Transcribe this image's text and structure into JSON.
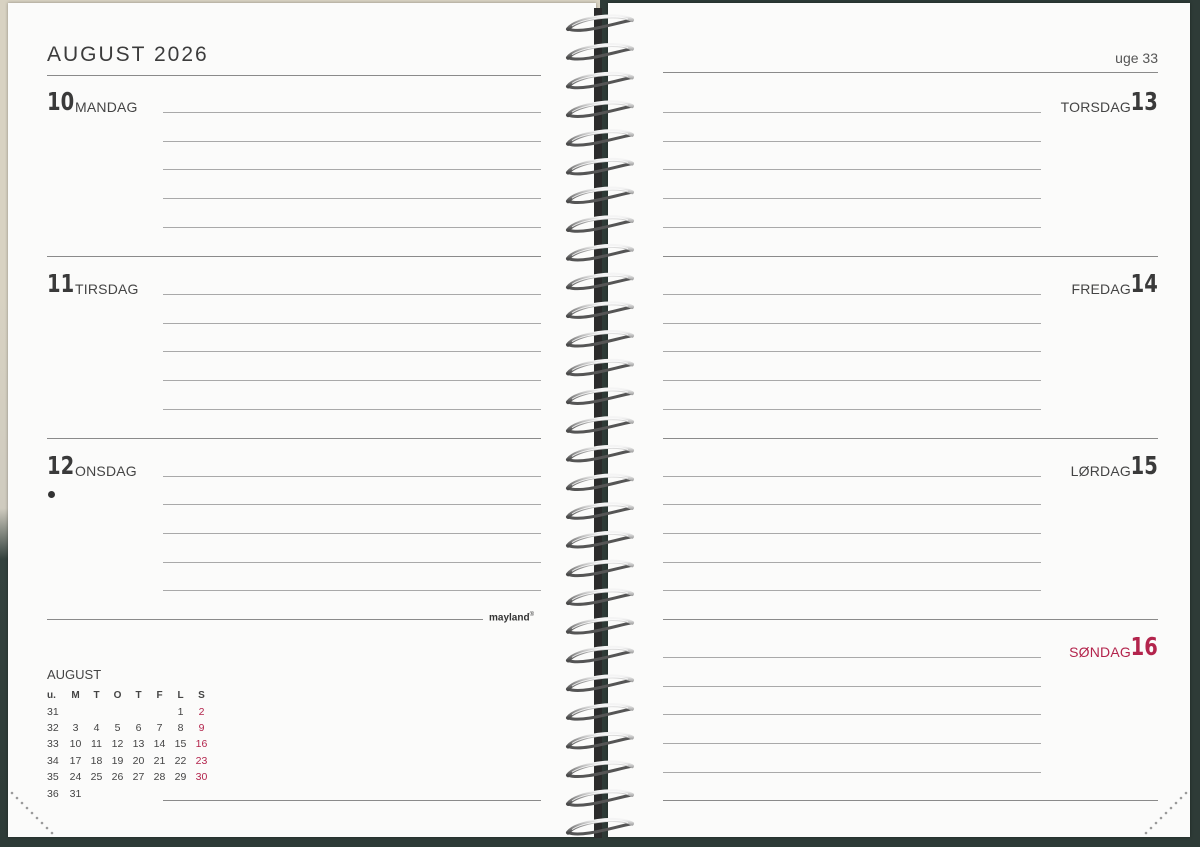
{
  "header": {
    "month_year": "AUGUST 2026",
    "week_label": "uge 33"
  },
  "days_left": [
    {
      "num": "10",
      "name": "MANDAG"
    },
    {
      "num": "11",
      "name": "TIRSDAG"
    },
    {
      "num": "12",
      "name": "ONSDAG"
    }
  ],
  "days_right": [
    {
      "num": "13",
      "name": "TORSDAG"
    },
    {
      "num": "14",
      "name": "FREDAG"
    },
    {
      "num": "15",
      "name": "LØRDAG"
    },
    {
      "num": "16",
      "name": "SØNDAG"
    }
  ],
  "brand": "mayland",
  "brand_mark": "®",
  "colors": {
    "sunday_accent": "#b3244c",
    "cover_dark": "#2e3b37",
    "cover_light": "#d8d2c2"
  },
  "mini_calendar": {
    "title": "AUGUST",
    "headers": [
      "u.",
      "M",
      "T",
      "O",
      "T",
      "F",
      "L",
      "S"
    ],
    "rows": [
      [
        "31",
        "",
        "",
        "",
        "",
        "",
        "1",
        "2"
      ],
      [
        "32",
        "3",
        "4",
        "5",
        "6",
        "7",
        "8",
        "9"
      ],
      [
        "33",
        "10",
        "11",
        "12",
        "13",
        "14",
        "15",
        "16"
      ],
      [
        "34",
        "17",
        "18",
        "19",
        "20",
        "21",
        "22",
        "23"
      ],
      [
        "35",
        "24",
        "25",
        "26",
        "27",
        "28",
        "29",
        "30"
      ],
      [
        "36",
        "31",
        "",
        "",
        "",
        "",
        "",
        ""
      ]
    ]
  }
}
